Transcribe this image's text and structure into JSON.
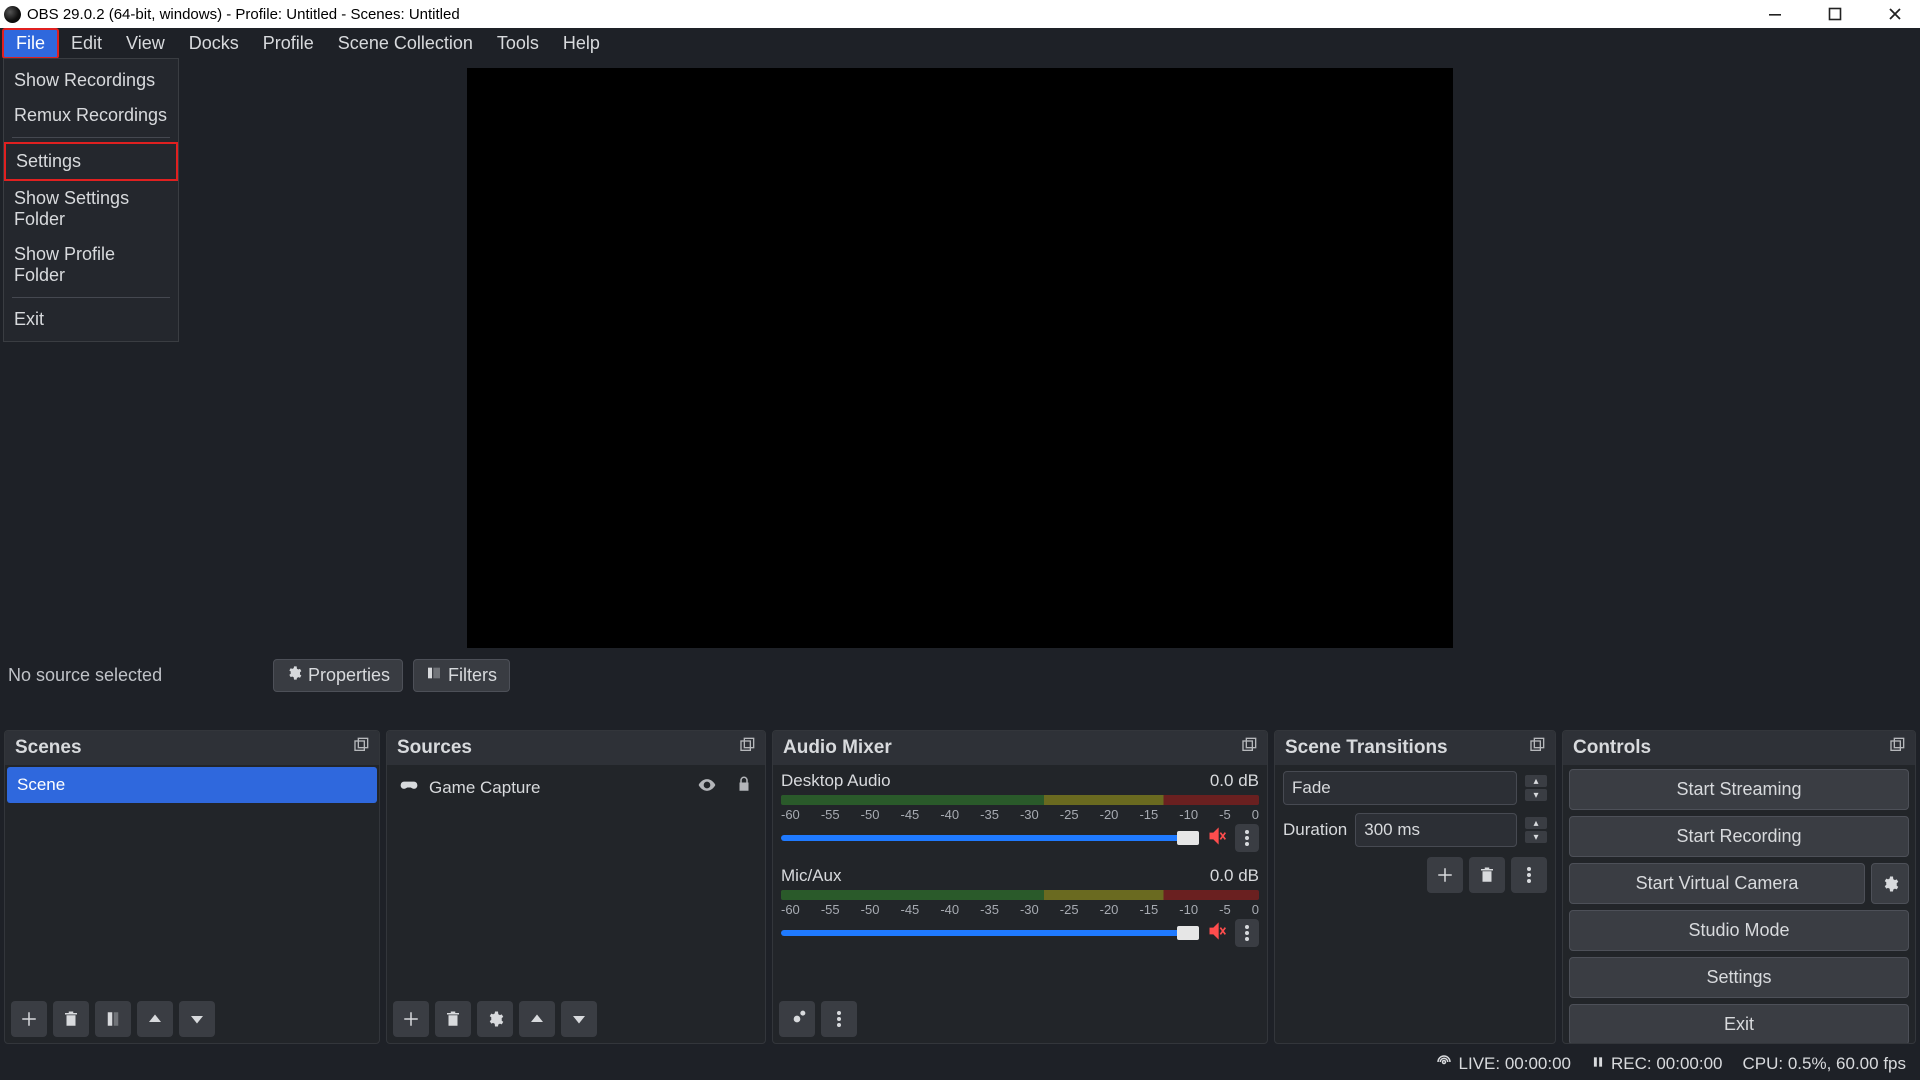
{
  "window": {
    "title": "OBS 29.0.2 (64-bit, windows) - Profile: Untitled - Scenes: Untitled"
  },
  "menu": {
    "items": [
      "File",
      "Edit",
      "View",
      "Docks",
      "Profile",
      "Scene Collection",
      "Tools",
      "Help"
    ]
  },
  "file_menu": {
    "items": [
      "Show Recordings",
      "Remux Recordings",
      "Settings",
      "Show Settings Folder",
      "Show Profile Folder",
      "Exit"
    ],
    "highlighted_index": 2
  },
  "infobar": {
    "status": "No source selected",
    "properties_label": "Properties",
    "filters_label": "Filters"
  },
  "scenes": {
    "title": "Scenes",
    "items": [
      "Scene"
    ],
    "selected": 0
  },
  "sources": {
    "title": "Sources",
    "items": [
      {
        "name": "Game Capture",
        "type_icon": "gamepad"
      }
    ]
  },
  "mixer": {
    "title": "Audio Mixer",
    "ticks": [
      "-60",
      "-55",
      "-50",
      "-45",
      "-40",
      "-35",
      "-30",
      "-25",
      "-20",
      "-15",
      "-10",
      "-5",
      "0"
    ],
    "channels": [
      {
        "name": "Desktop Audio",
        "db": "0.0 dB",
        "muted": true
      },
      {
        "name": "Mic/Aux",
        "db": "0.0 dB",
        "muted": true
      }
    ]
  },
  "transitions": {
    "title": "Scene Transitions",
    "type": "Fade",
    "duration_label": "Duration",
    "duration_value": "300 ms"
  },
  "controls": {
    "title": "Controls",
    "start_streaming": "Start Streaming",
    "start_recording": "Start Recording",
    "start_virtual_camera": "Start Virtual Camera",
    "studio_mode": "Studio Mode",
    "settings": "Settings",
    "exit": "Exit"
  },
  "statusbar": {
    "live": "LIVE: 00:00:00",
    "rec": "REC: 00:00:00",
    "cpu": "CPU: 0.5%, 60.00 fps"
  }
}
